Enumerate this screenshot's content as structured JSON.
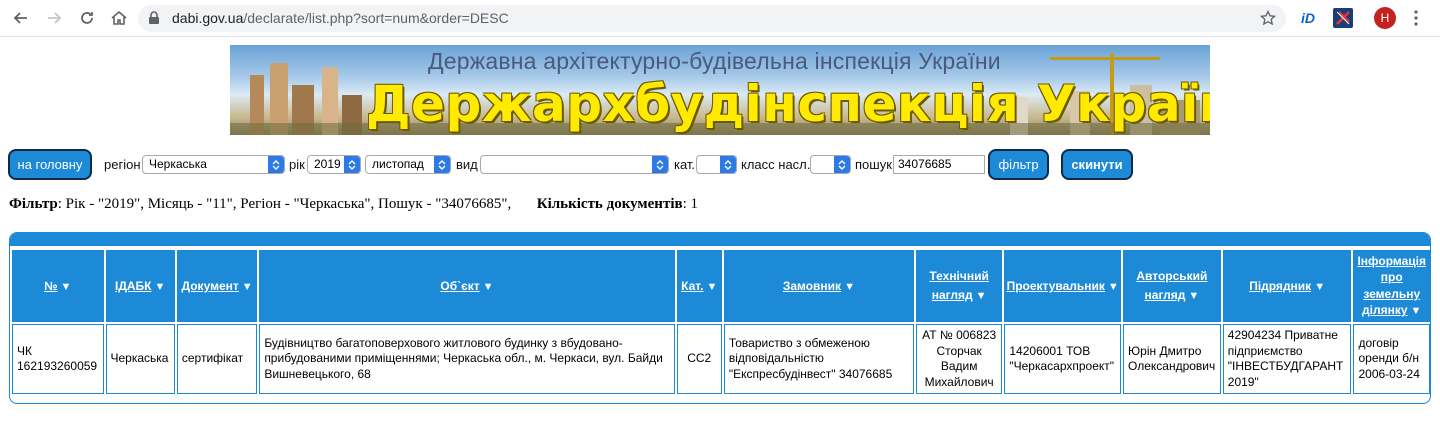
{
  "browser": {
    "url_host": "dabi.gov.ua",
    "url_path": "/declarate/list.php?sort=num&order=DESC",
    "avatar_letter": "H",
    "ext_id_label": "iD"
  },
  "banner": {
    "subtitle": "Державна архітектурно-будівельна інспекція України",
    "title": "Держархбудінспекція України"
  },
  "filters": {
    "home_button": "на головну",
    "region_label": "регіон",
    "region_value": "Черкаська",
    "year_label": "рік",
    "year_value": "2019",
    "month_value": "листопад",
    "type_label": "вид",
    "type_value": "",
    "cat_label": "кат.",
    "cat_value": "",
    "class_label": "класс насл.",
    "class_value": "",
    "search_label": "пошук",
    "search_value": "34076685",
    "filter_button": "фільтр",
    "reset_button": "скинути"
  },
  "summary": {
    "filter_label": "Фільтр",
    "filter_text": ": Рік - \"2019\", Місяць - \"11\", Регіон - \"Черкаська\", Пошук - \"34076685\",",
    "count_label": "Кількість документів",
    "count_text": ": 1"
  },
  "table": {
    "columns": [
      "№",
      "ІДАБК",
      "Документ",
      "Об`єкт",
      "Кат.",
      "Замовник",
      "Технічний нагляд",
      "Проектувальник",
      "Авторський нагляд",
      "Підрядник",
      "Інформація про земельну ділянку"
    ],
    "rows": [
      {
        "num": "ЧК 162193260059",
        "idabk": "Черкаська",
        "doc": "сертифікат",
        "object": "Будівництво багатоповерхового житлового будинку з вбудовано-прибудованими приміщеннями; Черкаська обл., м. Черкаси, вул. Байди Вишневецького, 68",
        "cat": "СС2",
        "customer": "Товариство з обмеженою відповідальністю \"Експресбудінвест\" 34076685",
        "tech": "АТ № 006823 Сторчак Вадим Михайлович",
        "designer": "14206001 ТОВ \"Черкасархпроект\"",
        "author": "Юрін Дмитро Олександрович",
        "contractor": "42904234 Приватне підприємство \"ІНВЕСТБУДГАРАНТ 2019\"",
        "land": "договір оренди б/н 2006-03-24"
      }
    ]
  }
}
